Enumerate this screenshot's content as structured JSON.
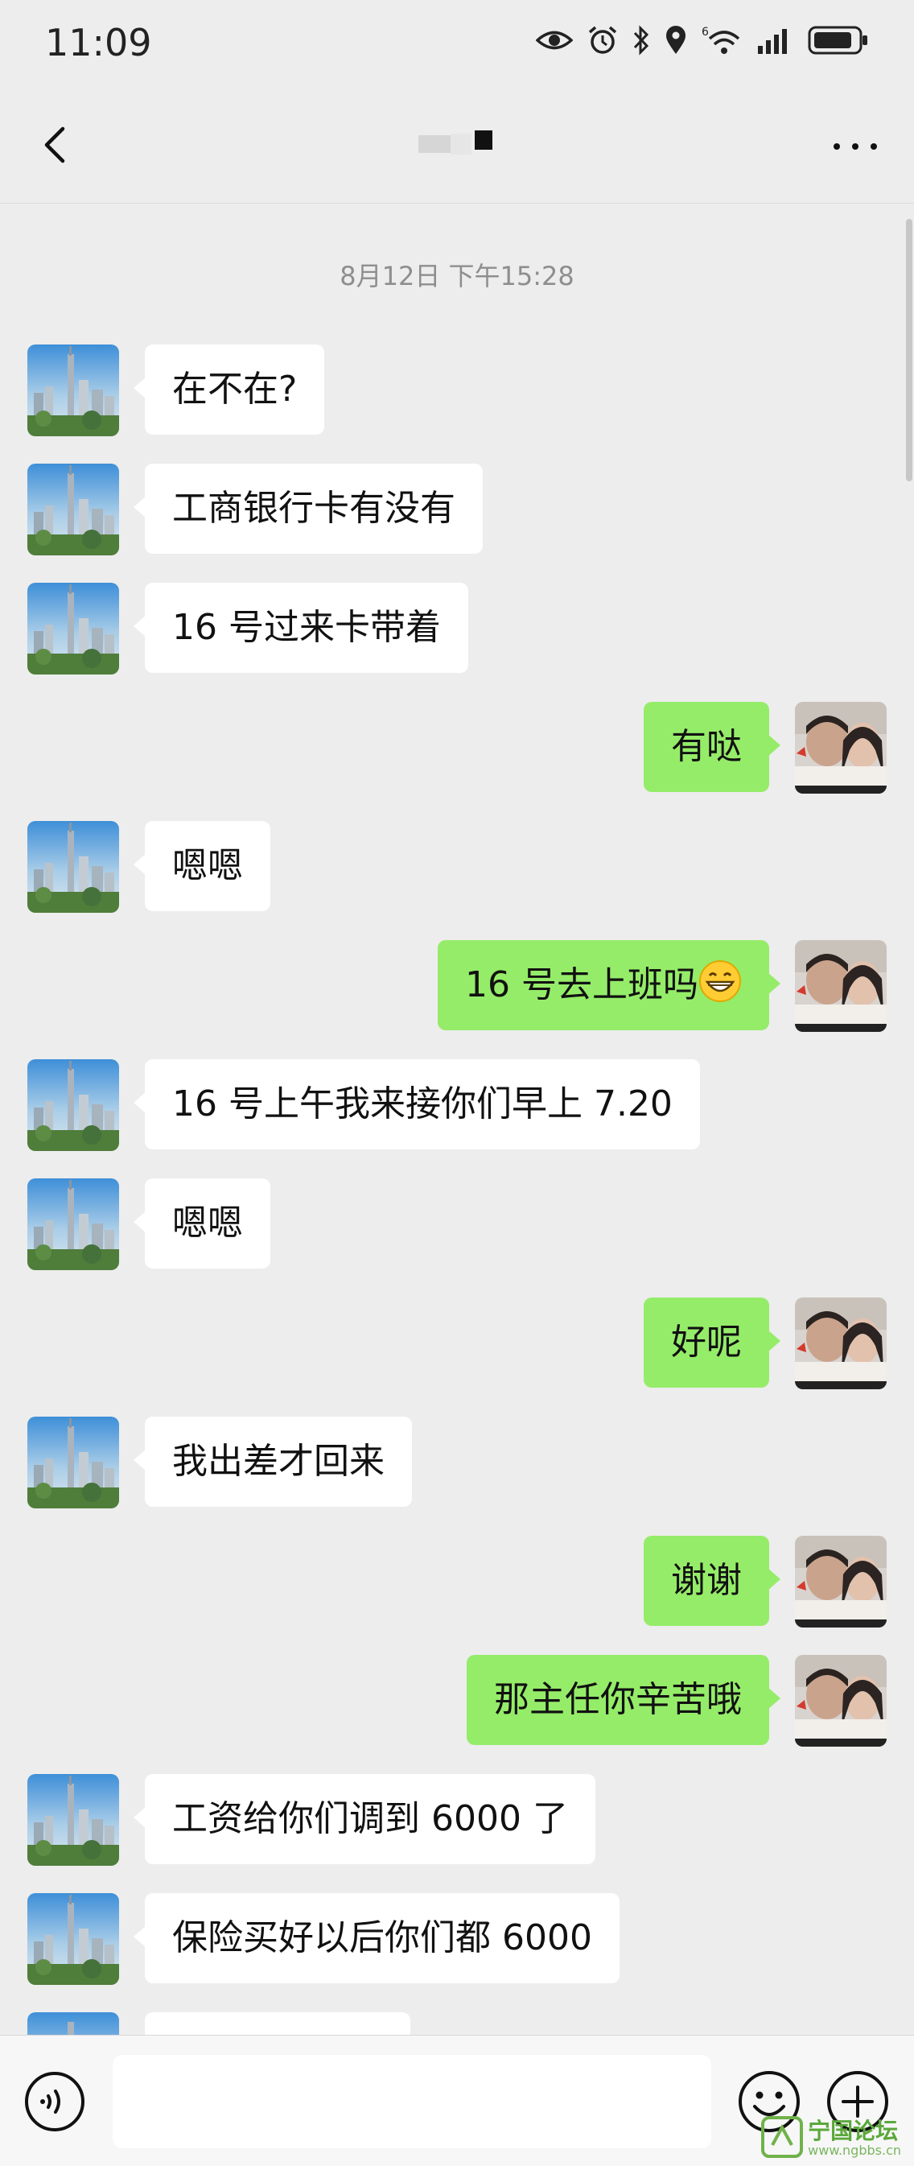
{
  "status_bar": {
    "time": "11:09",
    "icons": [
      "eye-icon",
      "alarm-icon",
      "bluetooth-icon",
      "location-icon",
      "wifi-6-icon",
      "signal-icon",
      "battery-icon"
    ],
    "wifi_badge": "6"
  },
  "navbar": {
    "back_icon": "chevron-left-icon",
    "more_icon": "more-dots-icon"
  },
  "chat": {
    "timestamp": "8月12日 下午15:28",
    "messages": [
      {
        "side": "left",
        "text": "在不在?"
      },
      {
        "side": "left",
        "text": "工商银行卡有没有"
      },
      {
        "side": "left",
        "text": "16 号过来卡带着"
      },
      {
        "side": "right",
        "text": "有哒"
      },
      {
        "side": "left",
        "text": "嗯嗯"
      },
      {
        "side": "right",
        "text": "16 号去上班吗",
        "emoji": "grinning-face-icon"
      },
      {
        "side": "left",
        "text": "16 号上午我来接你们早上 7.20"
      },
      {
        "side": "left",
        "text": "嗯嗯"
      },
      {
        "side": "right",
        "text": "好呢"
      },
      {
        "side": "left",
        "text": "我出差才回来"
      },
      {
        "side": "right",
        "text": "谢谢"
      },
      {
        "side": "right",
        "text": "那主任你辛苦哦"
      },
      {
        "side": "left",
        "text": "工资给你们调到 6000 了"
      },
      {
        "side": "left",
        "text": "保险买好以后你们都 6000"
      }
    ]
  },
  "bottom_bar": {
    "voice_icon": "voice-icon",
    "emoji_icon": "emoji-icon",
    "plus_icon": "plus-icon"
  },
  "watermark": {
    "title": "宁国论坛",
    "url": "www.ngbbs.cn"
  },
  "colors": {
    "background": "#ededed",
    "bubble_left": "#ffffff",
    "bubble_right": "#95ec69",
    "timestamp": "#8e8e8e"
  }
}
